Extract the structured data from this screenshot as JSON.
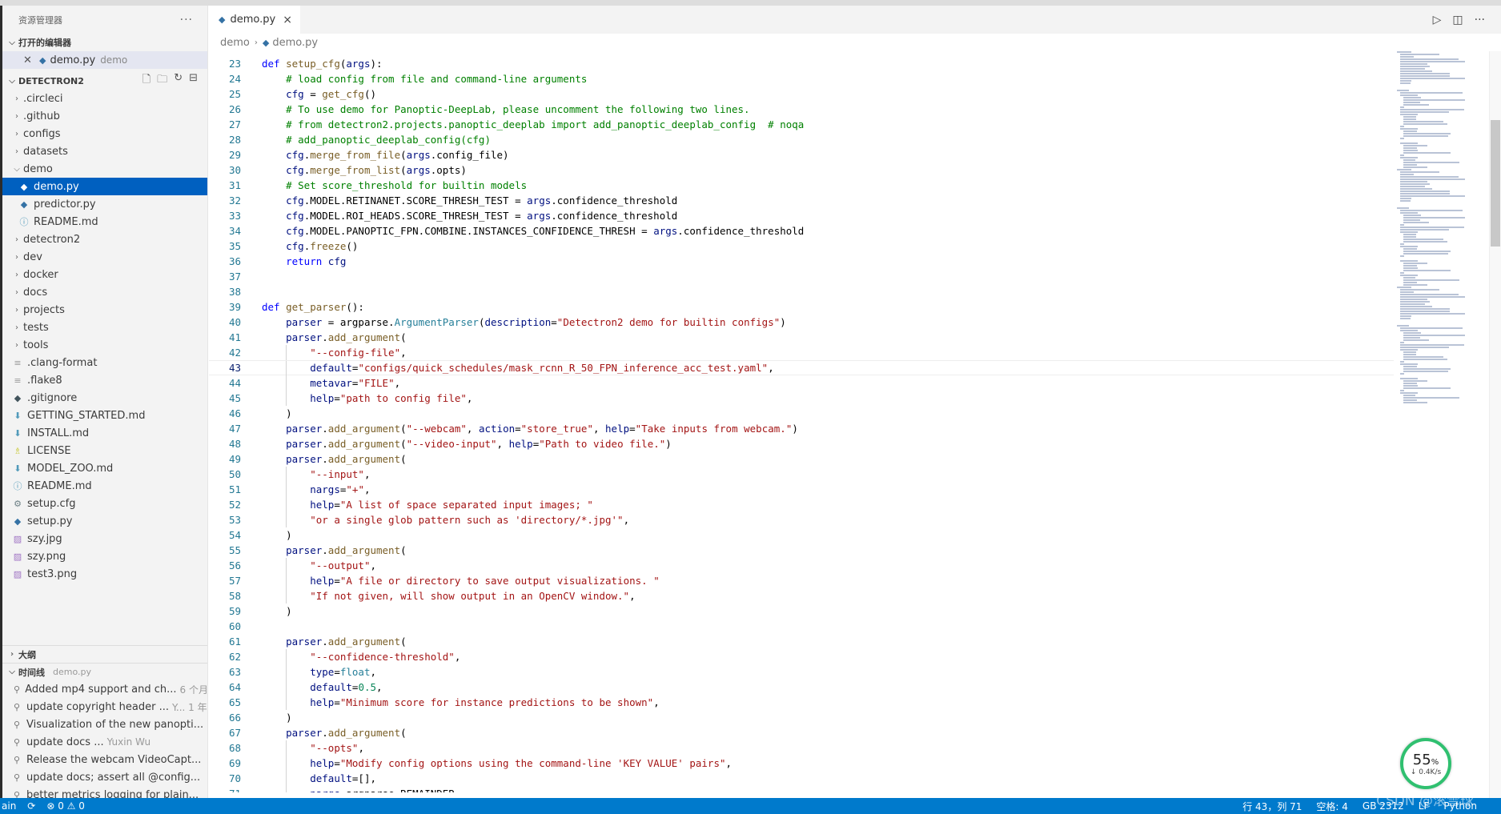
{
  "explorer": {
    "title": "资源管理器",
    "more": "···",
    "open_editors_label": "打开的编辑器",
    "open_editor": {
      "name": "demo.py",
      "folder": "demo"
    },
    "project_label": "DETECTRON2",
    "tree": [
      {
        "name": ".circleci",
        "type": "folder",
        "depth": 0
      },
      {
        "name": ".github",
        "type": "folder",
        "depth": 0
      },
      {
        "name": "configs",
        "type": "folder",
        "depth": 0
      },
      {
        "name": "datasets",
        "type": "folder",
        "depth": 0
      },
      {
        "name": "demo",
        "type": "folder-open",
        "depth": 0
      },
      {
        "name": "demo.py",
        "type": "py",
        "depth": 1,
        "selected": true
      },
      {
        "name": "predictor.py",
        "type": "py",
        "depth": 1
      },
      {
        "name": "README.md",
        "type": "info",
        "depth": 1
      },
      {
        "name": "detectron2",
        "type": "folder",
        "depth": 0
      },
      {
        "name": "dev",
        "type": "folder",
        "depth": 0
      },
      {
        "name": "docker",
        "type": "folder",
        "depth": 0
      },
      {
        "name": "docs",
        "type": "folder",
        "depth": 0
      },
      {
        "name": "projects",
        "type": "folder",
        "depth": 0
      },
      {
        "name": "tests",
        "type": "folder",
        "depth": 0
      },
      {
        "name": "tools",
        "type": "folder",
        "depth": 0
      },
      {
        "name": ".clang-format",
        "type": "lines",
        "depth": 0
      },
      {
        "name": ".flake8",
        "type": "lines",
        "depth": 0
      },
      {
        "name": ".gitignore",
        "type": "git",
        "depth": 0
      },
      {
        "name": "GETTING_STARTED.md",
        "type": "md",
        "depth": 0
      },
      {
        "name": "INSTALL.md",
        "type": "md",
        "depth": 0
      },
      {
        "name": "LICENSE",
        "type": "license",
        "depth": 0
      },
      {
        "name": "MODEL_ZOO.md",
        "type": "md",
        "depth": 0
      },
      {
        "name": "README.md",
        "type": "info",
        "depth": 0
      },
      {
        "name": "setup.cfg",
        "type": "gear",
        "depth": 0
      },
      {
        "name": "setup.py",
        "type": "py",
        "depth": 0
      },
      {
        "name": "szy.jpg",
        "type": "img",
        "depth": 0
      },
      {
        "name": "szy.png",
        "type": "img",
        "depth": 0
      },
      {
        "name": "test3.png",
        "type": "img",
        "depth": 0
      }
    ],
    "outline_label": "大纲",
    "timeline_label": "时间线",
    "timeline_file": "demo.py",
    "timeline": [
      {
        "text": "Added mp4 support and ch...",
        "meta": "6 个月"
      },
      {
        "text": "update copyright header ...",
        "meta": "Y...  1 年"
      },
      {
        "text": "Visualization of the new panopti...",
        "meta": ""
      },
      {
        "text": "update docs ...",
        "meta": "Yuxin Wu"
      },
      {
        "text": "Release the webcam VideoCapt...",
        "meta": ""
      },
      {
        "text": "update docs; assert all @config...",
        "meta": ""
      },
      {
        "text": "better metrics logging for plain...",
        "meta": ""
      }
    ]
  },
  "tab": {
    "name": "demo.py",
    "close": "×"
  },
  "breadcrumb": {
    "folder": "demo",
    "file": "demo.py"
  },
  "code_lines": [
    {
      "n": 23,
      "indent": 0,
      "tokens": [
        [
          "kw",
          "def "
        ],
        [
          "fn",
          "setup_cfg"
        ],
        [
          "",
          "("
        ],
        [
          "vr",
          "args"
        ],
        [
          "",
          "):"
        ]
      ]
    },
    {
      "n": 24,
      "indent": 1,
      "tokens": [
        [
          "cm",
          "# load config from file and command-line arguments"
        ]
      ]
    },
    {
      "n": 25,
      "indent": 1,
      "tokens": [
        [
          "vr",
          "cfg"
        ],
        [
          "",
          " = "
        ],
        [
          "fn",
          "get_cfg"
        ],
        [
          "",
          "()"
        ]
      ]
    },
    {
      "n": 26,
      "indent": 1,
      "tokens": [
        [
          "cm",
          "# To use demo for Panoptic-DeepLab, please uncomment the following two lines."
        ]
      ]
    },
    {
      "n": 27,
      "indent": 1,
      "tokens": [
        [
          "cm",
          "# from detectron2.projects.panoptic_deeplab import add_panoptic_deeplab_config  # noqa"
        ]
      ]
    },
    {
      "n": 28,
      "indent": 1,
      "tokens": [
        [
          "cm",
          "# add_panoptic_deeplab_config(cfg)"
        ]
      ]
    },
    {
      "n": 29,
      "indent": 1,
      "tokens": [
        [
          "vr",
          "cfg"
        ],
        [
          "",
          "."
        ],
        [
          "fn",
          "merge_from_file"
        ],
        [
          "",
          "("
        ],
        [
          "vr",
          "args"
        ],
        [
          "",
          ".config_file)"
        ]
      ]
    },
    {
      "n": 30,
      "indent": 1,
      "tokens": [
        [
          "vr",
          "cfg"
        ],
        [
          "",
          "."
        ],
        [
          "fn",
          "merge_from_list"
        ],
        [
          "",
          "("
        ],
        [
          "vr",
          "args"
        ],
        [
          "",
          ".opts)"
        ]
      ]
    },
    {
      "n": 31,
      "indent": 1,
      "tokens": [
        [
          "cm",
          "# Set score_threshold for builtin models"
        ]
      ]
    },
    {
      "n": 32,
      "indent": 1,
      "tokens": [
        [
          "vr",
          "cfg"
        ],
        [
          "",
          ".MODEL.RETINANET.SCORE_THRESH_TEST = "
        ],
        [
          "vr",
          "args"
        ],
        [
          "",
          ".confidence_threshold"
        ]
      ]
    },
    {
      "n": 33,
      "indent": 1,
      "tokens": [
        [
          "vr",
          "cfg"
        ],
        [
          "",
          ".MODEL.ROI_HEADS.SCORE_THRESH_TEST = "
        ],
        [
          "vr",
          "args"
        ],
        [
          "",
          ".confidence_threshold"
        ]
      ]
    },
    {
      "n": 34,
      "indent": 1,
      "tokens": [
        [
          "vr",
          "cfg"
        ],
        [
          "",
          ".MODEL.PANOPTIC_FPN.COMBINE.INSTANCES_CONFIDENCE_THRESH = "
        ],
        [
          "vr",
          "args"
        ],
        [
          "",
          ".confidence_threshold"
        ]
      ]
    },
    {
      "n": 35,
      "indent": 1,
      "tokens": [
        [
          "vr",
          "cfg"
        ],
        [
          "",
          "."
        ],
        [
          "fn",
          "freeze"
        ],
        [
          "",
          "()"
        ]
      ]
    },
    {
      "n": 36,
      "indent": 1,
      "tokens": [
        [
          "kw",
          "return "
        ],
        [
          "vr",
          "cfg"
        ]
      ]
    },
    {
      "n": 37,
      "indent": 0,
      "tokens": []
    },
    {
      "n": 38,
      "indent": 0,
      "tokens": []
    },
    {
      "n": 39,
      "indent": 0,
      "tokens": [
        [
          "kw",
          "def "
        ],
        [
          "fn",
          "get_parser"
        ],
        [
          "",
          "():"
        ]
      ]
    },
    {
      "n": 40,
      "indent": 1,
      "tokens": [
        [
          "vr",
          "parser"
        ],
        [
          "",
          " = argparse."
        ],
        [
          "cls",
          "ArgumentParser"
        ],
        [
          "",
          "("
        ],
        [
          "vr",
          "description"
        ],
        [
          "",
          "="
        ],
        [
          "str",
          "\"Detectron2 demo for builtin configs\""
        ],
        [
          "",
          ")"
        ]
      ]
    },
    {
      "n": 41,
      "indent": 1,
      "tokens": [
        [
          "vr",
          "parser"
        ],
        [
          "",
          "."
        ],
        [
          "fn",
          "add_argument"
        ],
        [
          "",
          "("
        ]
      ]
    },
    {
      "n": 42,
      "indent": 2,
      "tokens": [
        [
          "str",
          "\"--config-file\""
        ],
        [
          "",
          ","
        ]
      ]
    },
    {
      "n": 43,
      "indent": 2,
      "current": true,
      "tokens": [
        [
          "vr",
          "default"
        ],
        [
          "",
          "="
        ],
        [
          "str",
          "\"configs/quick_schedules/mask_rcnn_R_50_FPN_inference_acc_test.yaml\""
        ],
        [
          "",
          ","
        ]
      ]
    },
    {
      "n": 44,
      "indent": 2,
      "tokens": [
        [
          "vr",
          "metavar"
        ],
        [
          "",
          "="
        ],
        [
          "str",
          "\"FILE\""
        ],
        [
          "",
          ","
        ]
      ]
    },
    {
      "n": 45,
      "indent": 2,
      "tokens": [
        [
          "vr",
          "help"
        ],
        [
          "",
          "="
        ],
        [
          "str",
          "\"path to config file\""
        ],
        [
          "",
          ","
        ]
      ]
    },
    {
      "n": 46,
      "indent": 1,
      "tokens": [
        [
          "",
          ")"
        ]
      ]
    },
    {
      "n": 47,
      "indent": 1,
      "tokens": [
        [
          "vr",
          "parser"
        ],
        [
          "",
          "."
        ],
        [
          "fn",
          "add_argument"
        ],
        [
          "",
          "("
        ],
        [
          "str",
          "\"--webcam\""
        ],
        [
          "",
          ", "
        ],
        [
          "vr",
          "action"
        ],
        [
          "",
          "="
        ],
        [
          "str",
          "\"store_true\""
        ],
        [
          "",
          ", "
        ],
        [
          "vr",
          "help"
        ],
        [
          "",
          "="
        ],
        [
          "str",
          "\"Take inputs from webcam.\""
        ],
        [
          "",
          ")"
        ]
      ]
    },
    {
      "n": 48,
      "indent": 1,
      "tokens": [
        [
          "vr",
          "parser"
        ],
        [
          "",
          "."
        ],
        [
          "fn",
          "add_argument"
        ],
        [
          "",
          "("
        ],
        [
          "str",
          "\"--video-input\""
        ],
        [
          "",
          ", "
        ],
        [
          "vr",
          "help"
        ],
        [
          "",
          "="
        ],
        [
          "str",
          "\"Path to video file.\""
        ],
        [
          "",
          ")"
        ]
      ]
    },
    {
      "n": 49,
      "indent": 1,
      "tokens": [
        [
          "vr",
          "parser"
        ],
        [
          "",
          "."
        ],
        [
          "fn",
          "add_argument"
        ],
        [
          "",
          "("
        ]
      ]
    },
    {
      "n": 50,
      "indent": 2,
      "tokens": [
        [
          "str",
          "\"--input\""
        ],
        [
          "",
          ","
        ]
      ]
    },
    {
      "n": 51,
      "indent": 2,
      "tokens": [
        [
          "vr",
          "nargs"
        ],
        [
          "",
          "="
        ],
        [
          "str",
          "\"+\""
        ],
        [
          "",
          ","
        ]
      ]
    },
    {
      "n": 52,
      "indent": 2,
      "tokens": [
        [
          "vr",
          "help"
        ],
        [
          "",
          "="
        ],
        [
          "str",
          "\"A list of space separated input images; \""
        ]
      ]
    },
    {
      "n": 53,
      "indent": 2,
      "tokens": [
        [
          "str",
          "\"or a single glob pattern such as 'directory/*.jpg'\""
        ],
        [
          "",
          ","
        ]
      ]
    },
    {
      "n": 54,
      "indent": 1,
      "tokens": [
        [
          "",
          ")"
        ]
      ]
    },
    {
      "n": 55,
      "indent": 1,
      "tokens": [
        [
          "vr",
          "parser"
        ],
        [
          "",
          "."
        ],
        [
          "fn",
          "add_argument"
        ],
        [
          "",
          "("
        ]
      ]
    },
    {
      "n": 56,
      "indent": 2,
      "tokens": [
        [
          "str",
          "\"--output\""
        ],
        [
          "",
          ","
        ]
      ]
    },
    {
      "n": 57,
      "indent": 2,
      "tokens": [
        [
          "vr",
          "help"
        ],
        [
          "",
          "="
        ],
        [
          "str",
          "\"A file or directory to save output visualizations. \""
        ]
      ]
    },
    {
      "n": 58,
      "indent": 2,
      "tokens": [
        [
          "str",
          "\"If not given, will show output in an OpenCV window.\""
        ],
        [
          "",
          ","
        ]
      ]
    },
    {
      "n": 59,
      "indent": 1,
      "tokens": [
        [
          "",
          ")"
        ]
      ]
    },
    {
      "n": 60,
      "indent": 0,
      "tokens": []
    },
    {
      "n": 61,
      "indent": 1,
      "tokens": [
        [
          "vr",
          "parser"
        ],
        [
          "",
          "."
        ],
        [
          "fn",
          "add_argument"
        ],
        [
          "",
          "("
        ]
      ]
    },
    {
      "n": 62,
      "indent": 2,
      "tokens": [
        [
          "str",
          "\"--confidence-threshold\""
        ],
        [
          "",
          ","
        ]
      ]
    },
    {
      "n": 63,
      "indent": 2,
      "tokens": [
        [
          "vr",
          "type"
        ],
        [
          "",
          "="
        ],
        [
          "cls",
          "float"
        ],
        [
          "",
          ","
        ]
      ]
    },
    {
      "n": 64,
      "indent": 2,
      "tokens": [
        [
          "vr",
          "default"
        ],
        [
          "",
          "="
        ],
        [
          "num",
          "0.5"
        ],
        [
          "",
          ","
        ]
      ]
    },
    {
      "n": 65,
      "indent": 2,
      "tokens": [
        [
          "vr",
          "help"
        ],
        [
          "",
          "="
        ],
        [
          "str",
          "\"Minimum score for instance predictions to be shown\""
        ],
        [
          "",
          ","
        ]
      ]
    },
    {
      "n": 66,
      "indent": 1,
      "tokens": [
        [
          "",
          ")"
        ]
      ]
    },
    {
      "n": 67,
      "indent": 1,
      "tokens": [
        [
          "vr",
          "parser"
        ],
        [
          "",
          "."
        ],
        [
          "fn",
          "add_argument"
        ],
        [
          "",
          "("
        ]
      ]
    },
    {
      "n": 68,
      "indent": 2,
      "tokens": [
        [
          "str",
          "\"--opts\""
        ],
        [
          "",
          ","
        ]
      ]
    },
    {
      "n": 69,
      "indent": 2,
      "tokens": [
        [
          "vr",
          "help"
        ],
        [
          "",
          "="
        ],
        [
          "str",
          "\"Modify config options using the command-line 'KEY VALUE' pairs\""
        ],
        [
          "",
          ","
        ]
      ]
    },
    {
      "n": 70,
      "indent": 2,
      "tokens": [
        [
          "vr",
          "default"
        ],
        [
          "",
          "=[],"
        ]
      ]
    },
    {
      "n": 71,
      "indent": 2,
      "tokens": [
        [
          "vr",
          "nargs"
        ],
        [
          "",
          "=argparse.REMAINDER,"
        ]
      ]
    }
  ],
  "netwidget": {
    "percent": "55",
    "percent_unit": "%",
    "speed": "0.4K/s"
  },
  "statusbar": {
    "branch": "ain",
    "sync": "⟳",
    "problems": "⊗ 0 ⚠ 0",
    "cursor": "行 43，列 71",
    "spaces": "空格: 4",
    "encoding": "GB 2312",
    "eol": "LF",
    "language": "Python"
  },
  "watermark": "CSDN @滚雪球"
}
